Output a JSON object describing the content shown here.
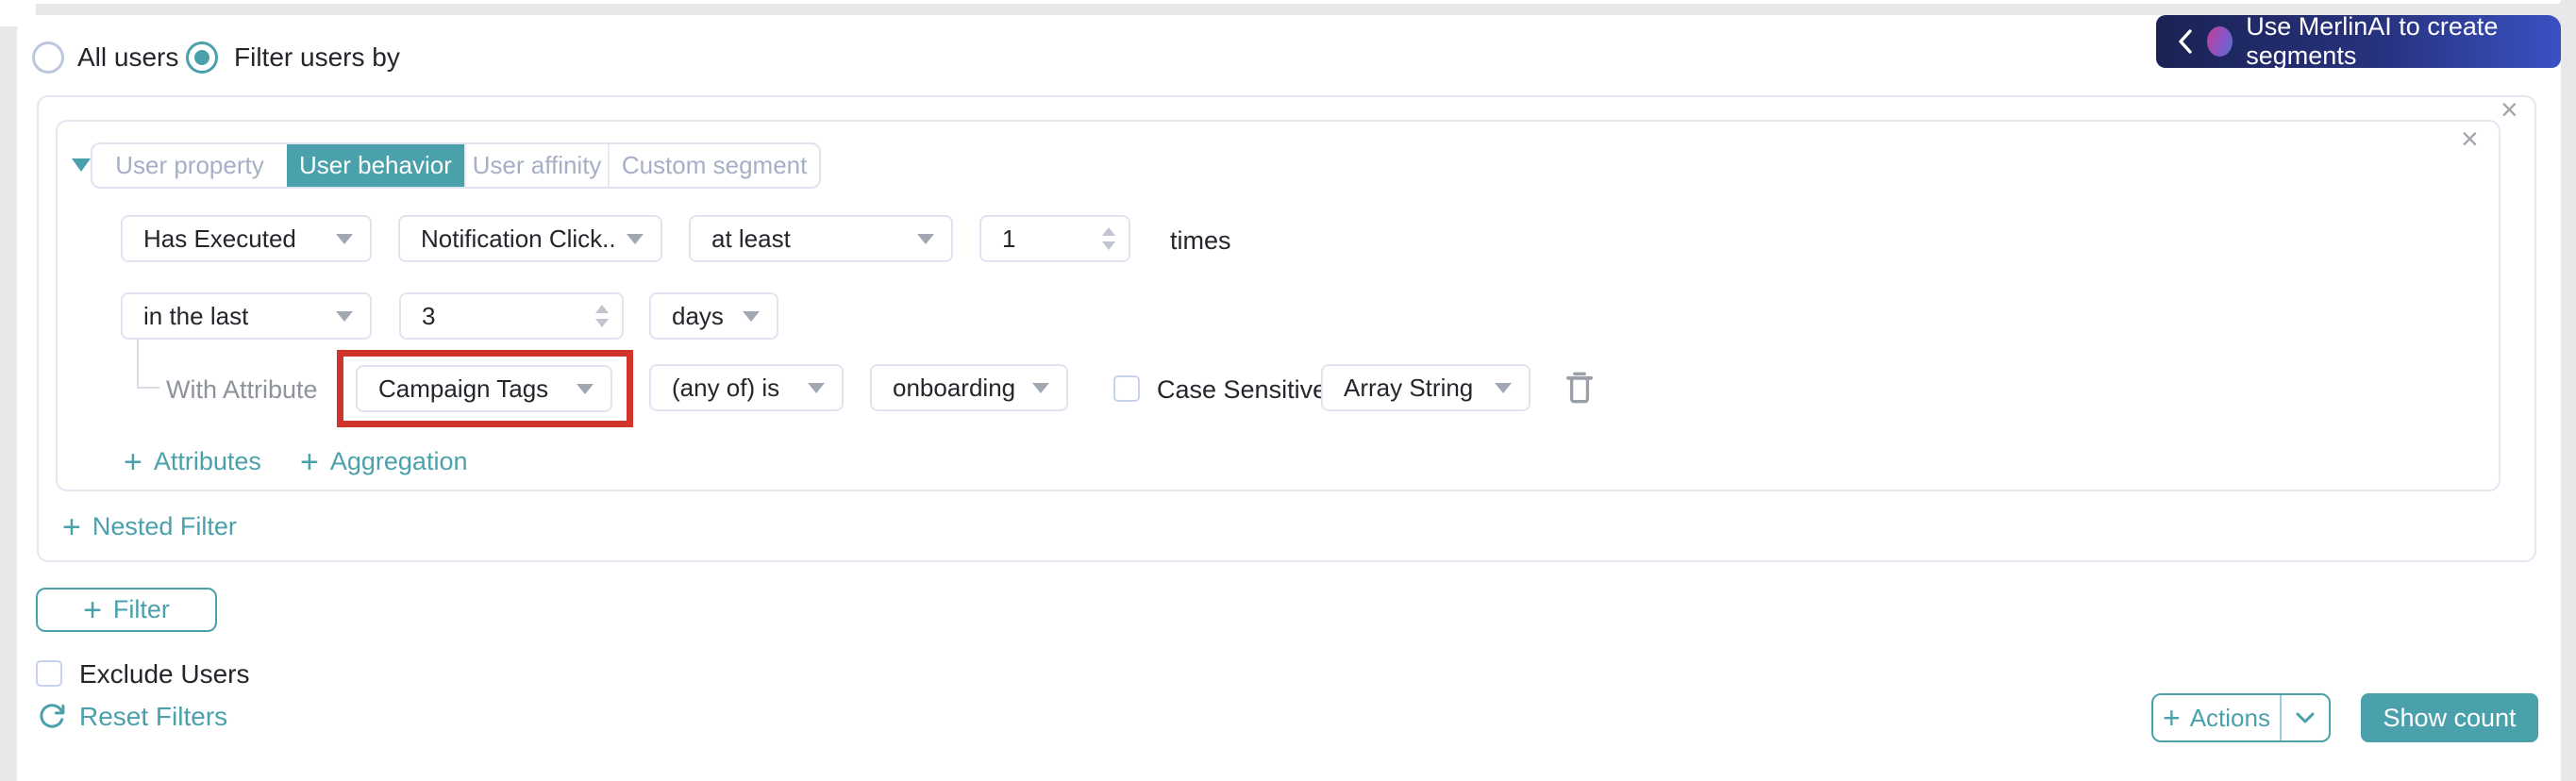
{
  "icons": {
    "plus": "+",
    "close": "×"
  },
  "colors": {
    "teal": "#4AA1AC",
    "highlight_red": "#D0342C",
    "merlin_gradient_start": "#1A2353",
    "merlin_gradient_end": "#3A51C2"
  },
  "user_type": {
    "all_users": "All users",
    "filter_users_by": "Filter users by",
    "selected": "Filter users by"
  },
  "merlin": {
    "label": "Use MerlinAI to create segments"
  },
  "filter_card": {
    "tabs": [
      {
        "label": "User property",
        "active": false
      },
      {
        "label": "User behavior",
        "active": true
      },
      {
        "label": "User affinity",
        "active": false
      },
      {
        "label": "Custom segment",
        "active": false
      }
    ],
    "behavior_row": {
      "condition": "Has Executed",
      "event": "Notification Click...",
      "comparator": "at least",
      "count": "1",
      "count_suffix": "times"
    },
    "time_row": {
      "window": "in the last",
      "value": "3",
      "unit": "days"
    },
    "attribute_row": {
      "label": "With Attribute",
      "attribute": "Campaign Tags",
      "operator": "(any of) is",
      "value": "onboarding",
      "case_sensitive_label": "Case Sensitive",
      "case_sensitive_checked": false,
      "type": "Array String"
    },
    "add_attributes_label": "Attributes",
    "add_aggregation_label": "Aggregation",
    "add_nested_filter_label": "Nested Filter"
  },
  "footer": {
    "add_filter_label": "Filter",
    "exclude_users_label": "Exclude Users",
    "exclude_users_checked": false,
    "reset_filters_label": "Reset Filters",
    "actions_label": "Actions",
    "show_count_label": "Show count"
  }
}
